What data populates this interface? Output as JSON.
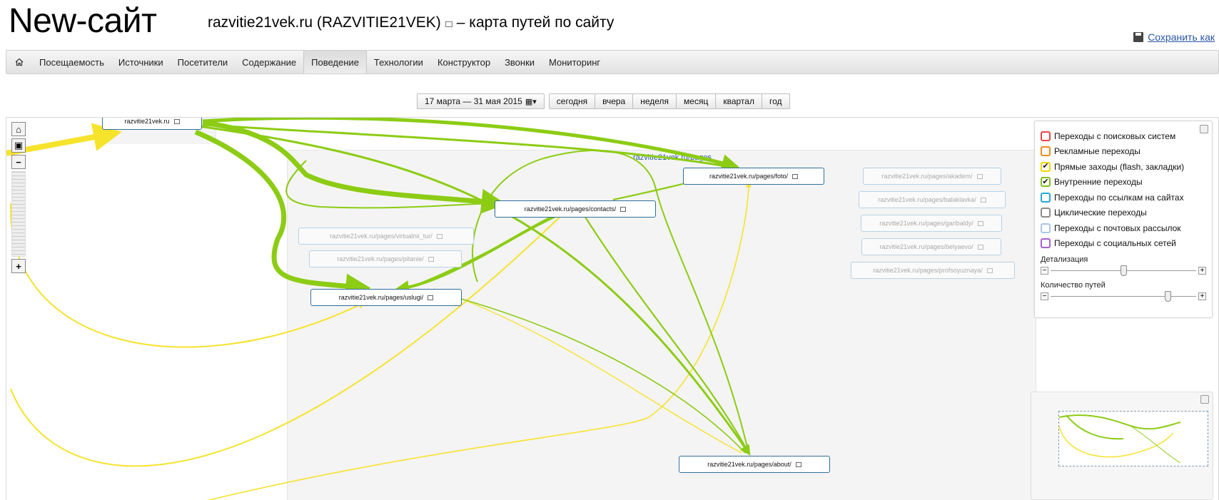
{
  "header": {
    "site_title": "New-сайт",
    "counter": "razvitie21vek.ru (RAZVITIE21VEK)",
    "map_title": "– карта путей по сайту",
    "save_label": "Сохранить как"
  },
  "menu": {
    "items": [
      "Посещаемость",
      "Источники",
      "Посетители",
      "Содержание",
      "Поведение",
      "Технологии",
      "Конструктор",
      "Звонки",
      "Мониторинг"
    ],
    "active": "Поведение"
  },
  "period": {
    "range": "17 марта — 31 мая 2015",
    "presets": [
      "сегодня",
      "вчера",
      "неделя",
      "месяц",
      "квартал",
      "год"
    ]
  },
  "map": {
    "group_label": "razvitie21vek.ru/pages",
    "nodes": {
      "root": "razvitie21vek.ru",
      "foto": "razvitie21vek.ru/pages/foto/",
      "contacts": "razvitie21vek.ru/pages/contacts/",
      "uslugi": "razvitie21vek.ru/pages/uslugi/",
      "about": "razvitie21vek.ru/pages/about/",
      "virtualnii_tur": "razvitie21vek.ru/pages/virtualnii_tur/",
      "pitanie": "razvitie21vek.ru/pages/pitanie/",
      "akadem": "razvitie21vek.ru/pages/akadem/",
      "balaklavka": "razvitie21vek.ru/pages/balaklavka/",
      "garibaldy": "razvitie21vek.ru/pages/garibaldy/",
      "belyaevo": "razvitie21vek.ru/pages/belyaevo/",
      "profsoyuznaya": "razvitie21vek.ru/pages/profsoyuznaya/"
    },
    "colors": {
      "internal": "#8ccc14",
      "direct": "#f6e32b",
      "node_border": "#2f6f9a"
    }
  },
  "legend": {
    "items": [
      {
        "label": "Переходы с поисковых систем",
        "color": "#e84545",
        "checked": false
      },
      {
        "label": "Рекламные переходы",
        "color": "#f08a1c",
        "checked": false
      },
      {
        "label": "Прямые заходы (flash, закладки)",
        "color": "#f2d600",
        "checked": true
      },
      {
        "label": "Внутренние переходы",
        "color": "#7fbf1e",
        "checked": true
      },
      {
        "label": "Переходы по ссылкам на сайтах",
        "color": "#22a8e0",
        "checked": false
      },
      {
        "label": "Циклические переходы",
        "color": "#8c8c8c",
        "checked": false
      },
      {
        "label": "Переходы с почтовых рассылок",
        "color": "#a9c6e8",
        "checked": false
      },
      {
        "label": "Переходы с социальных сетей",
        "color": "#a65fd4",
        "checked": false
      }
    ],
    "detail_label": "Детализация",
    "detail_value": 0.55,
    "paths_label": "Количество путей",
    "paths_value": 0.85
  }
}
